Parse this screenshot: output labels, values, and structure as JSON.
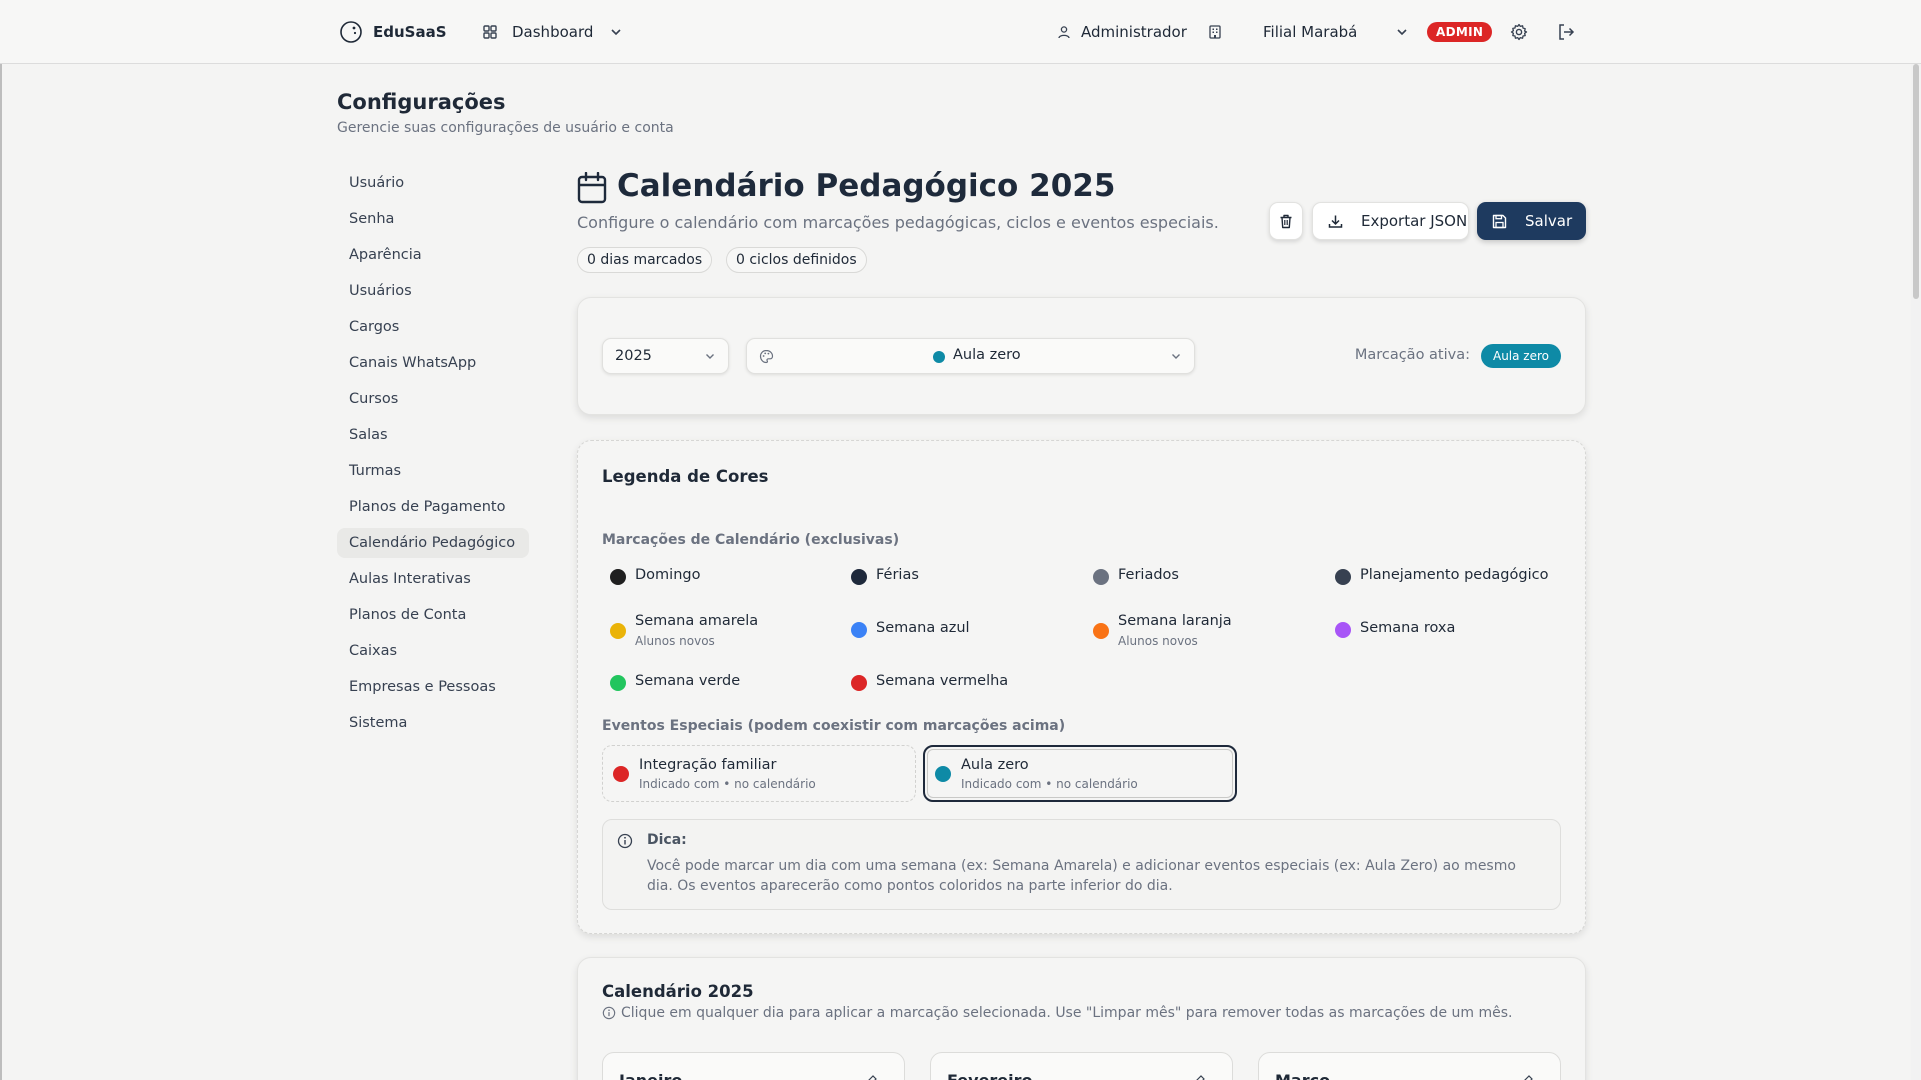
{
  "header": {
    "brand": "EduSaaS",
    "nav_label": "Dashboard",
    "user_label": "Administrador",
    "branch_label": "Filial Marabá",
    "role_badge": "ADMIN"
  },
  "page": {
    "title": "Configurações",
    "subtitle": "Gerencie suas configurações de usuário e conta"
  },
  "sidebar": {
    "items": [
      {
        "label": "Usuário"
      },
      {
        "label": "Senha"
      },
      {
        "label": "Aparência"
      },
      {
        "label": "Usuários"
      },
      {
        "label": "Cargos"
      },
      {
        "label": "Canais WhatsApp"
      },
      {
        "label": "Cursos"
      },
      {
        "label": "Salas"
      },
      {
        "label": "Turmas"
      },
      {
        "label": "Planos de Pagamento"
      },
      {
        "label": "Calendário Pedagógico"
      },
      {
        "label": "Aulas Interativas"
      },
      {
        "label": "Planos de Conta"
      },
      {
        "label": "Caixas"
      },
      {
        "label": "Empresas e Pessoas"
      },
      {
        "label": "Sistema"
      }
    ],
    "active_index": 10
  },
  "section": {
    "title": "Calendário Pedagógico 2025",
    "subtitle": "Configure o calendário com marcações pedagógicas, ciclos e eventos especiais.",
    "pill_days": "0 dias marcados",
    "pill_cycles": "0 ciclos definidos",
    "export_label": "Exportar JSON",
    "save_label": "Salvar"
  },
  "controls": {
    "year": "2025",
    "marking": "Aula zero",
    "marking_color": "#0e8aa6",
    "active_label": "Marcação ativa:",
    "active_value": "Aula zero"
  },
  "legend": {
    "title": "Legenda de Cores",
    "calendar_subtitle": "Marcações de Calendário (exclusivas)",
    "items": [
      {
        "name": "Domingo",
        "note": "",
        "color": "#1f1f1f"
      },
      {
        "name": "Férias",
        "note": "",
        "color": "#1e293b"
      },
      {
        "name": "Feriados",
        "note": "",
        "color": "#6b7280"
      },
      {
        "name": "Planejamento pedagógico",
        "note": "",
        "color": "#374151"
      },
      {
        "name": "Semana amarela",
        "note": "Alunos novos",
        "color": "#eab308"
      },
      {
        "name": "Semana azul",
        "note": "",
        "color": "#3b82f6"
      },
      {
        "name": "Semana laranja",
        "note": "Alunos novos",
        "color": "#f97316"
      },
      {
        "name": "Semana roxa",
        "note": "",
        "color": "#a855f7"
      },
      {
        "name": "Semana verde",
        "note": "",
        "color": "#22c55e"
      },
      {
        "name": "Semana vermelha",
        "note": "",
        "color": "#dc2626"
      }
    ],
    "events_subtitle": "Eventos Especiais (podem coexistir com marcações acima)",
    "events": [
      {
        "name": "Integração familiar",
        "note": "Indicado com • no calendário",
        "color": "#dc2626"
      },
      {
        "name": "Aula zero",
        "note": "Indicado com • no calendário",
        "color": "#0e8aa6"
      }
    ],
    "tip_title": "Dica:",
    "tip_text": "Você pode marcar um dia com uma semana (ex: Semana Amarela) e adicionar eventos especiais (ex: Aula Zero) ao mesmo dia. Os eventos aparecerão como pontos coloridos na parte inferior do dia."
  },
  "calendar": {
    "title": "Calendário 2025",
    "hint": "Clique em qualquer dia para aplicar a marcação selecionada. Use \"Limpar mês\" para remover todas as marcações de um mês.",
    "months": [
      "Janeiro",
      "Fevereiro",
      "Março"
    ]
  }
}
